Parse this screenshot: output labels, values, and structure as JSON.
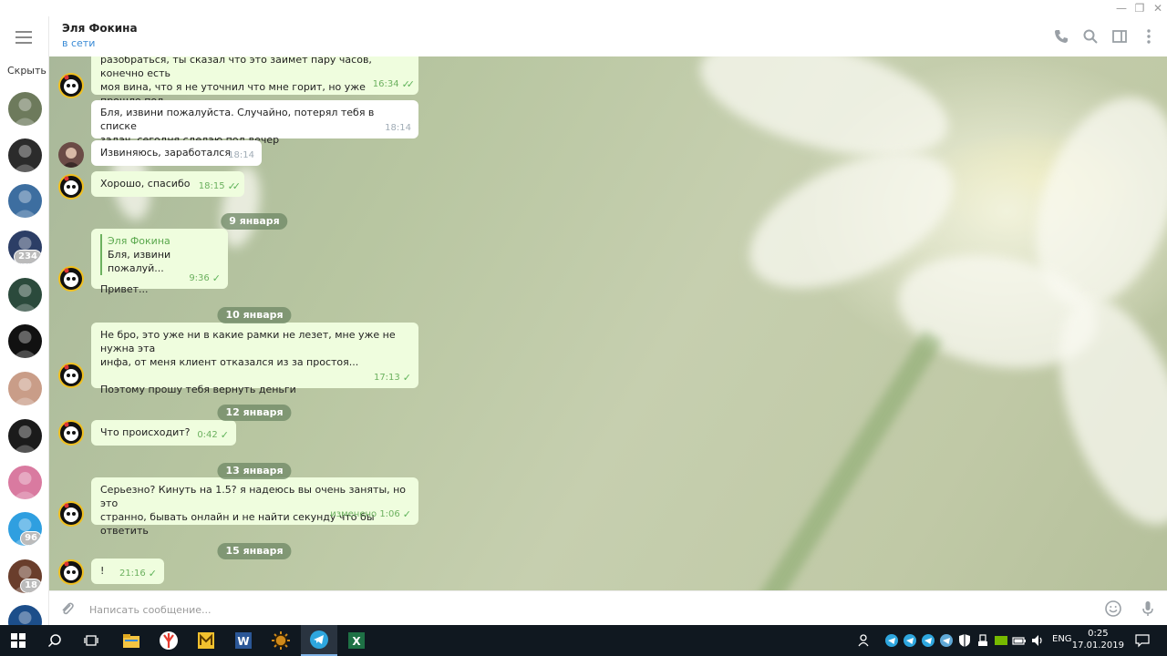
{
  "window": {
    "minimize_glyph": "—",
    "restore_glyph": "❐",
    "close_glyph": "✕"
  },
  "sidebar": {
    "hide_label": "Скрыть",
    "avatars": [
      {
        "name": "avatar-chat-1",
        "badge": null,
        "color": "#6d7a5c"
      },
      {
        "name": "avatar-chat-2",
        "badge": null,
        "color": "#2b2b2b"
      },
      {
        "name": "avatar-chat-3",
        "badge": null,
        "color": "#3d6ea0"
      },
      {
        "name": "avatar-chat-4",
        "badge": "234",
        "color": "#2c3e66"
      },
      {
        "name": "avatar-chat-5",
        "badge": null,
        "color": "#2b4a3c"
      },
      {
        "name": "avatar-chat-6",
        "badge": null,
        "color": "#111111"
      },
      {
        "name": "avatar-chat-7",
        "badge": null,
        "color": "#c99d88"
      },
      {
        "name": "avatar-chat-8",
        "badge": null,
        "color": "#1b1b1b"
      },
      {
        "name": "avatar-chat-9",
        "badge": null,
        "color": "#d97aa0"
      },
      {
        "name": "avatar-chat-10",
        "badge": "96",
        "color": "#2f9fe0"
      },
      {
        "name": "avatar-chat-11",
        "badge": "18",
        "color": "#6a3e2c"
      },
      {
        "name": "avatar-chat-12",
        "badge": null,
        "color": "#1c4e8a"
      }
    ]
  },
  "header": {
    "name": "Эля Фокина",
    "status": "в сети"
  },
  "chat": {
    "messages": [
      {
        "id": "m1",
        "dir": "out",
        "text": "разобраться, ты сказал что это займет пару часов, конечно есть\nмоя вина, что я не уточнил что мне горит, но уже прошло пол\nнедели, а я только скрипт получил...",
        "time": "16:34",
        "check": "double"
      },
      {
        "id": "m2",
        "dir": "in",
        "text": "Бля, извини пожалуйста. Случайно, потерял тебя в списке\nзадач, сегодня сделаю под вечер",
        "time": "18:14"
      },
      {
        "id": "m3",
        "dir": "in",
        "text": "Извиняюсь, заработался",
        "time": "18:14"
      },
      {
        "id": "m4",
        "dir": "out",
        "text": "Хорошо, спасибо",
        "time": "18:15",
        "check": "double"
      },
      {
        "id": "m5",
        "dir": "out",
        "quote_name": "Эля Фокина",
        "quote_text": "Бля, извини пожалуй...",
        "text": "Привет...",
        "time": "9:36",
        "check": "single"
      },
      {
        "id": "m6",
        "dir": "out",
        "text": "Не бро, это уже ни в какие рамки не лезет, мне уже не нужна эта\nинфа, от меня клиент отказался из за простоя...\n\nПоэтому прошу тебя вернуть деньги",
        "time": "17:13",
        "check": "single"
      },
      {
        "id": "m7",
        "dir": "out",
        "text": "Что происходит?",
        "time": "0:42",
        "check": "single"
      },
      {
        "id": "m8",
        "dir": "out",
        "text": "Серьезно? Кинуть на 1.5? я надеюсь вы очень заняты, но это\nстранно, бывать онлайн и не найти секунду что бы ответить",
        "time": "изменено 1:06",
        "check": "single"
      },
      {
        "id": "m9",
        "dir": "out",
        "text": "!",
        "time": "21:16",
        "check": "single"
      }
    ],
    "dates": [
      "9 января",
      "10 января",
      "12 января",
      "13 января",
      "15 января"
    ]
  },
  "input": {
    "placeholder": "Написать сообщение..."
  },
  "taskbar": {
    "lang": "ENG",
    "time": "0:25",
    "date": "17.01.2019",
    "apps": [
      "windows-start",
      "search",
      "task-view",
      "file-explorer",
      "yandex-browser",
      "miranda-app",
      "word",
      "sun-app",
      "telegram",
      "excel"
    ]
  },
  "colors": {
    "accent": "#3a8bd6",
    "outgoing_bubble": "#effdde",
    "check": "#5fb35a"
  }
}
